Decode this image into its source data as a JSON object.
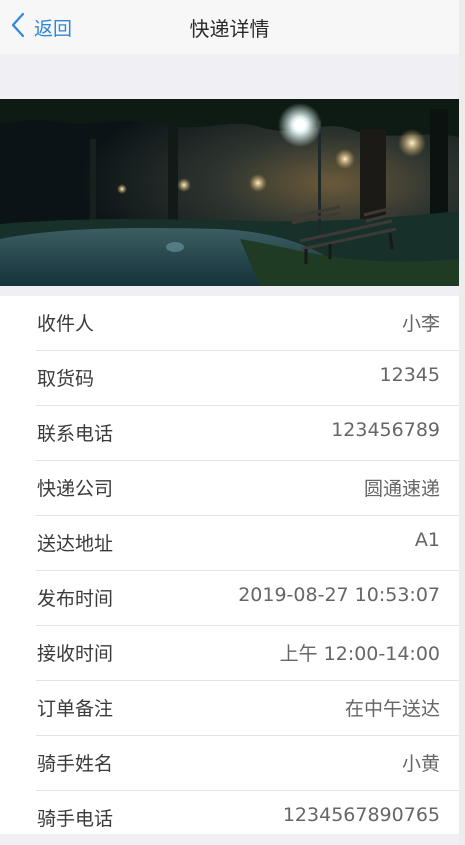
{
  "navbar": {
    "back_label": "返回",
    "title": "快递详情",
    "back_icon": "chevron-left-icon",
    "accent_color": "#2f87d8"
  },
  "hero_image": {
    "description_icon": "night-park-bench-photo"
  },
  "details": [
    {
      "label": "收件人",
      "value": "小李"
    },
    {
      "label": "取货码",
      "value": "12345"
    },
    {
      "label": "联系电话",
      "value": "123456789"
    },
    {
      "label": "快递公司",
      "value": "圆通速递"
    },
    {
      "label": "送达地址",
      "value": "A1"
    },
    {
      "label": "发布时间",
      "value": "2019-08-27 10:53:07"
    },
    {
      "label": "接收时间",
      "value": "上午 12:00-14:00"
    },
    {
      "label": "订单备注",
      "value": "在中午送达"
    },
    {
      "label": "骑手姓名",
      "value": "小黄"
    },
    {
      "label": "骑手电话",
      "value": "1234567890765"
    }
  ]
}
